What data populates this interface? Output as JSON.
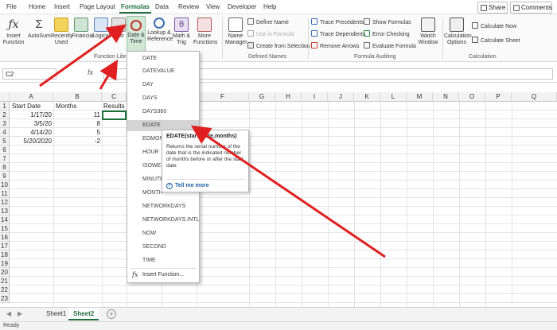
{
  "menu_tabs": [
    "File",
    "Home",
    "Insert",
    "Page Layout",
    "Formulas",
    "Data",
    "Review",
    "View",
    "Developer",
    "Help"
  ],
  "share_label": "Share",
  "comments_label": "Comments",
  "ribbon": {
    "insert_function": "Insert Function",
    "autosum": "AutoSum",
    "recently_used": "Recently Used",
    "financial": "Financial",
    "logical": "Logical",
    "text": "Text",
    "date_time": "Date & Time",
    "lookup_reference": "Lookup & Reference",
    "math_trig": "Math & Trig",
    "more_functions": "More Functions",
    "function_library_label": "Function Library",
    "name_manager": "Name Manager",
    "define_name": "Define Name",
    "use_in_formula": "Use in Formula",
    "create_from_selection": "Create from Selection",
    "defined_names_label": "Defined Names",
    "trace_precedents": "Trace Precedents",
    "trace_dependents": "Trace Dependents",
    "remove_arrows": "Remove Arrows",
    "show_formulas": "Show Formulas",
    "error_checking": "Error Checking",
    "evaluate_formula": "Evaluate Formula",
    "formula_auditing_label": "Formula Auditing",
    "watch_window": "Watch Window",
    "calculation_options": "Calculation Options",
    "calculate_now": "Calculate Now",
    "calculate_sheet": "Calculate Sheet",
    "calculation_label": "Calculation"
  },
  "name_box": "C2",
  "fx_symbol": "fx",
  "columns": [
    "A",
    "B",
    "C",
    "D",
    "E",
    "F",
    "G",
    "H",
    "I",
    "J",
    "K",
    "L",
    "M",
    "N",
    "O",
    "P",
    "Q"
  ],
  "rows": [
    "1",
    "2",
    "3",
    "4",
    "5",
    "6",
    "7",
    "8",
    "9",
    "10",
    "11",
    "12",
    "13",
    "14",
    "15",
    "16",
    "17",
    "18",
    "19",
    "20",
    "21",
    "22",
    "23"
  ],
  "cells": {
    "a1": "Start Date",
    "b1": "Months",
    "c1": "Results",
    "a2": "1/17/20",
    "b2": "11",
    "a3": "3/5/20",
    "b3": "8",
    "a4": "4/14/20",
    "b4": "5",
    "a5": "5/20/2020",
    "b5": "-2"
  },
  "dropdown": {
    "items": [
      "DATE",
      "DATEVALUE",
      "DAY",
      "DAYS",
      "DAYS360",
      "EDATE",
      "EOMONTH",
      "HOUR",
      "ISOWEEKNUM",
      "MINUTE",
      "MONTH",
      "NETWORKDAYS",
      "NETWORKDAYS.INTL",
      "NOW",
      "SECOND",
      "TIME"
    ],
    "insert_function": "Insert Function..."
  },
  "tooltip": {
    "title": "EDATE(start_date,months)",
    "body": "Returns the serial number of the date that is the indicated number of months before or after the start date.",
    "link": "Tell me more"
  },
  "sheets": [
    "Sheet1",
    "Sheet2"
  ],
  "active_sheet": "Sheet2",
  "status": "Ready",
  "colors": {
    "accent": "#1e6e3a",
    "annotation_arrow": "#e02020",
    "link": "#1f5fa8"
  }
}
